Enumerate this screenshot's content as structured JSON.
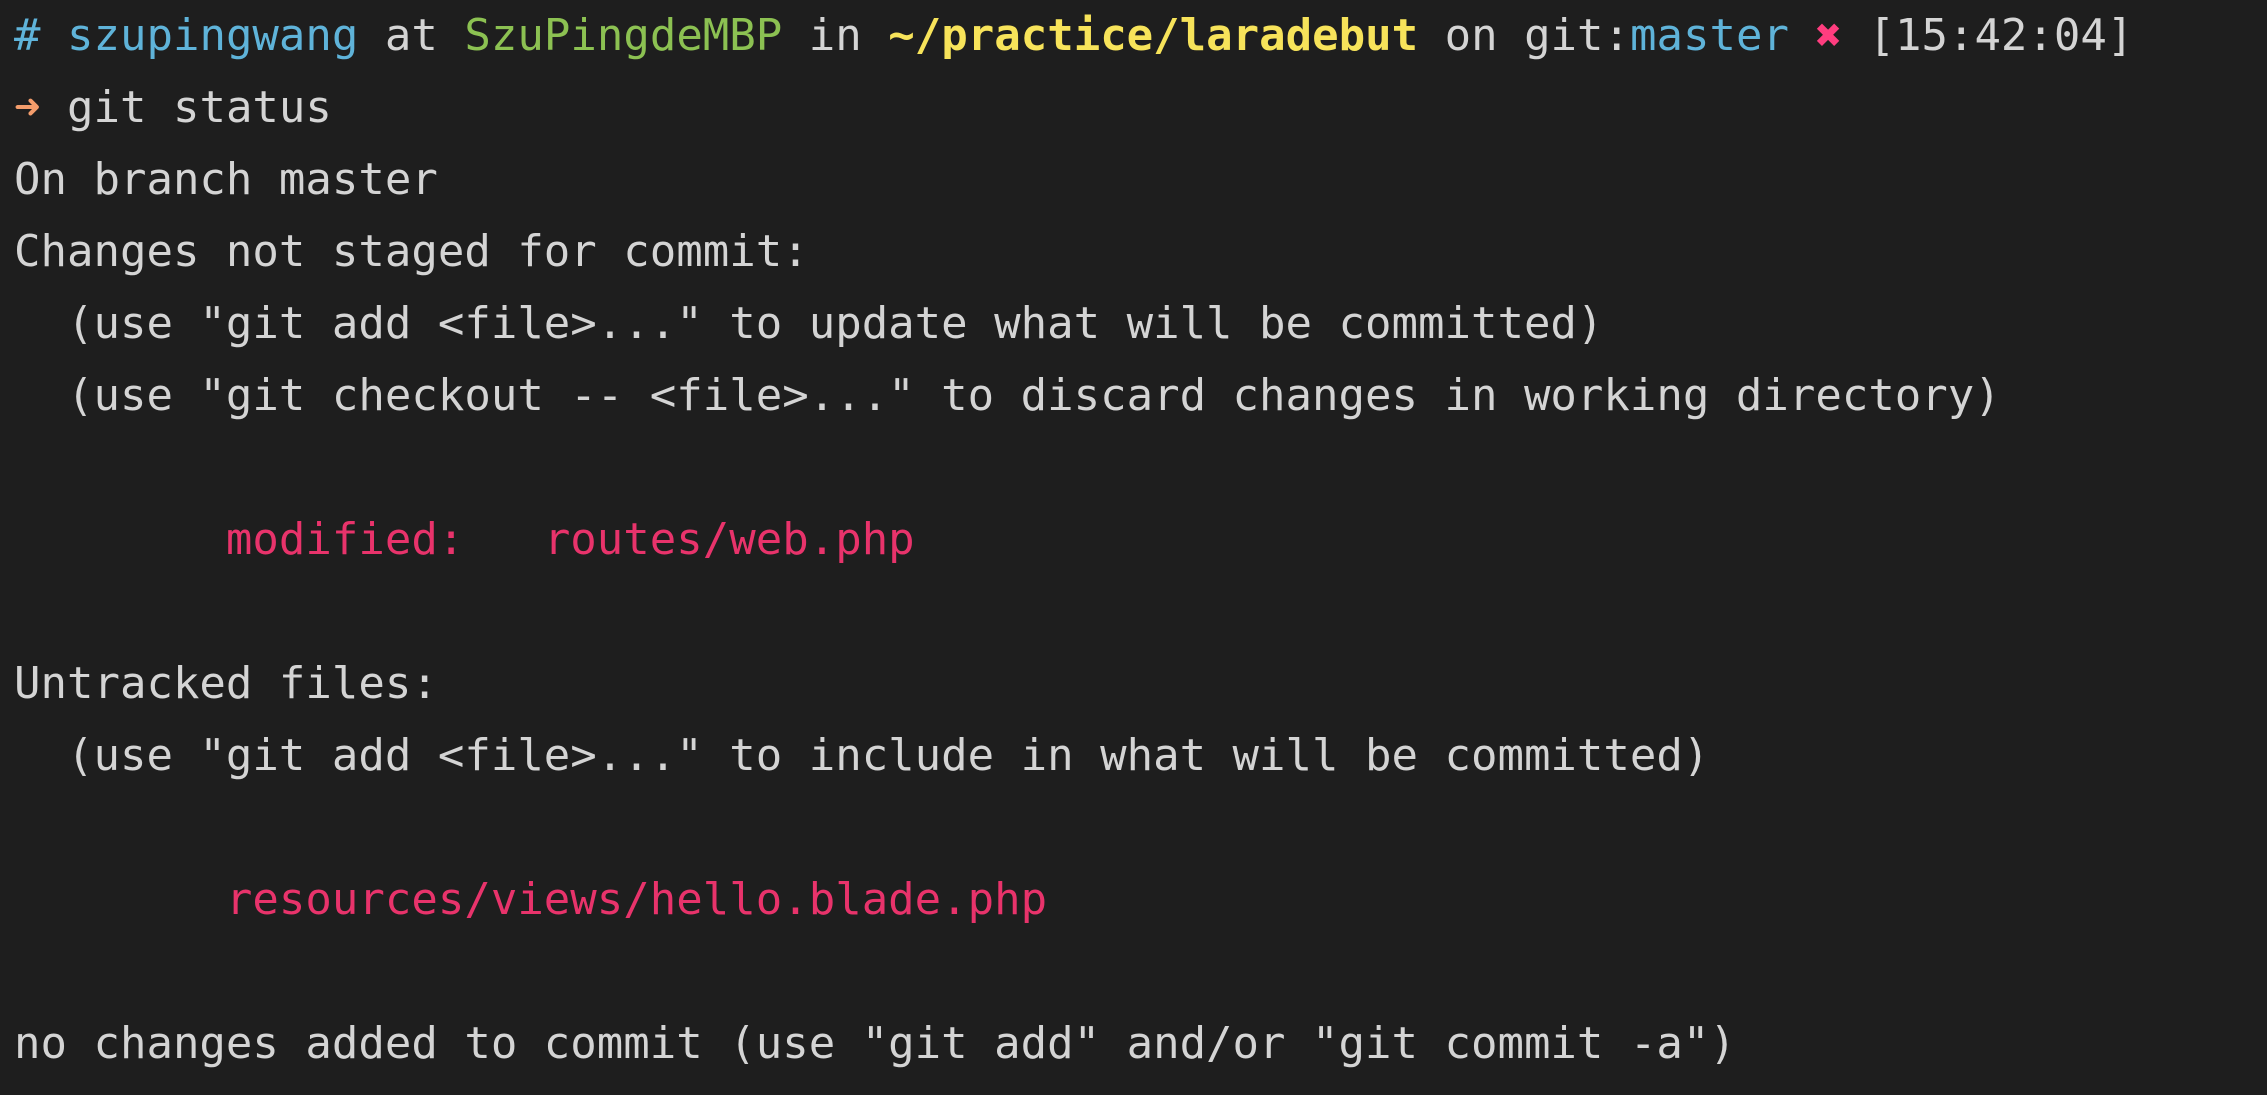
{
  "prompt": {
    "hash": "#",
    "user": "szupingwang",
    "at": "at",
    "host": "SzuPingdeMBP",
    "in": "in",
    "path": "~/practice/laradebut",
    "on": "on",
    "git_label": "git:",
    "branch": "master",
    "dirty_mark": "✖",
    "time": "[15:42:04]"
  },
  "command": {
    "arrow": "➜",
    "text": "git status"
  },
  "output": {
    "branch_line": "On branch master",
    "not_staged_header": "Changes not staged for commit:",
    "hint_add": "  (use \"git add <file>...\" to update what will be committed)",
    "hint_checkout": "  (use \"git checkout -- <file>...\" to discard changes in working directory)",
    "modified_label": "        modified:   ",
    "modified_file": "routes/web.php",
    "untracked_header": "Untracked files:",
    "hint_untracked": "  (use \"git add <file>...\" to include in what will be committed)",
    "untracked_file_indent": "        ",
    "untracked_file": "resources/views/hello.blade.php",
    "footer": "no changes added to commit (use \"git add\" and/or \"git commit -a\")"
  },
  "colors": {
    "background": "#1e1e1e",
    "text": "#d4d4d4",
    "cyan": "#5fb3d9",
    "green": "#8cc152",
    "yellow": "#f7e35a",
    "red": "#e8336b",
    "orange": "#f39c6b"
  }
}
